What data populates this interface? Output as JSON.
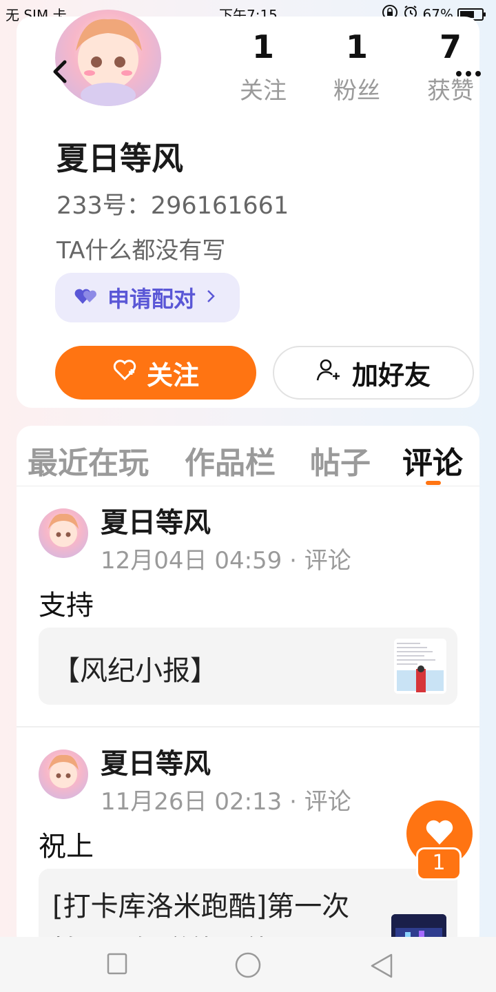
{
  "status_bar": {
    "carrier": "无 SIM 卡",
    "time": "下午7:15",
    "battery": "67%",
    "battery_level": 0.67
  },
  "profile": {
    "stats": [
      {
        "num": "1",
        "label": "关注"
      },
      {
        "num": "1",
        "label": "粉丝"
      },
      {
        "num": "7",
        "label": "获赞"
      }
    ],
    "nickname": "夏日等风",
    "uid": "233号：296161661",
    "bio": "TA什么都没有写",
    "pair_label": "申请配对",
    "follow_label": "关注",
    "add_friend_label": "加好友"
  },
  "tabs": [
    "最近在玩",
    "作品栏",
    "帖子",
    "评论"
  ],
  "active_tab": "评论",
  "comments": [
    {
      "author": "夏日等风",
      "meta": "12月04日 04:59 · 评论",
      "text": "支持",
      "card_title": "【风纪小报】"
    },
    {
      "author": "夏日等风",
      "meta": "11月26日 02:13 · 评论",
      "text": "祝上",
      "card_title_line1": "[打卡库洛米跑酷]第一次",
      "card_title_line2": "拍，不知道能不能火😏"
    }
  ],
  "like_fab": {
    "count": "1"
  },
  "colors": {
    "accent": "#ff7412",
    "pair": "#5a57d6",
    "pair_bg": "#ecebfb"
  }
}
